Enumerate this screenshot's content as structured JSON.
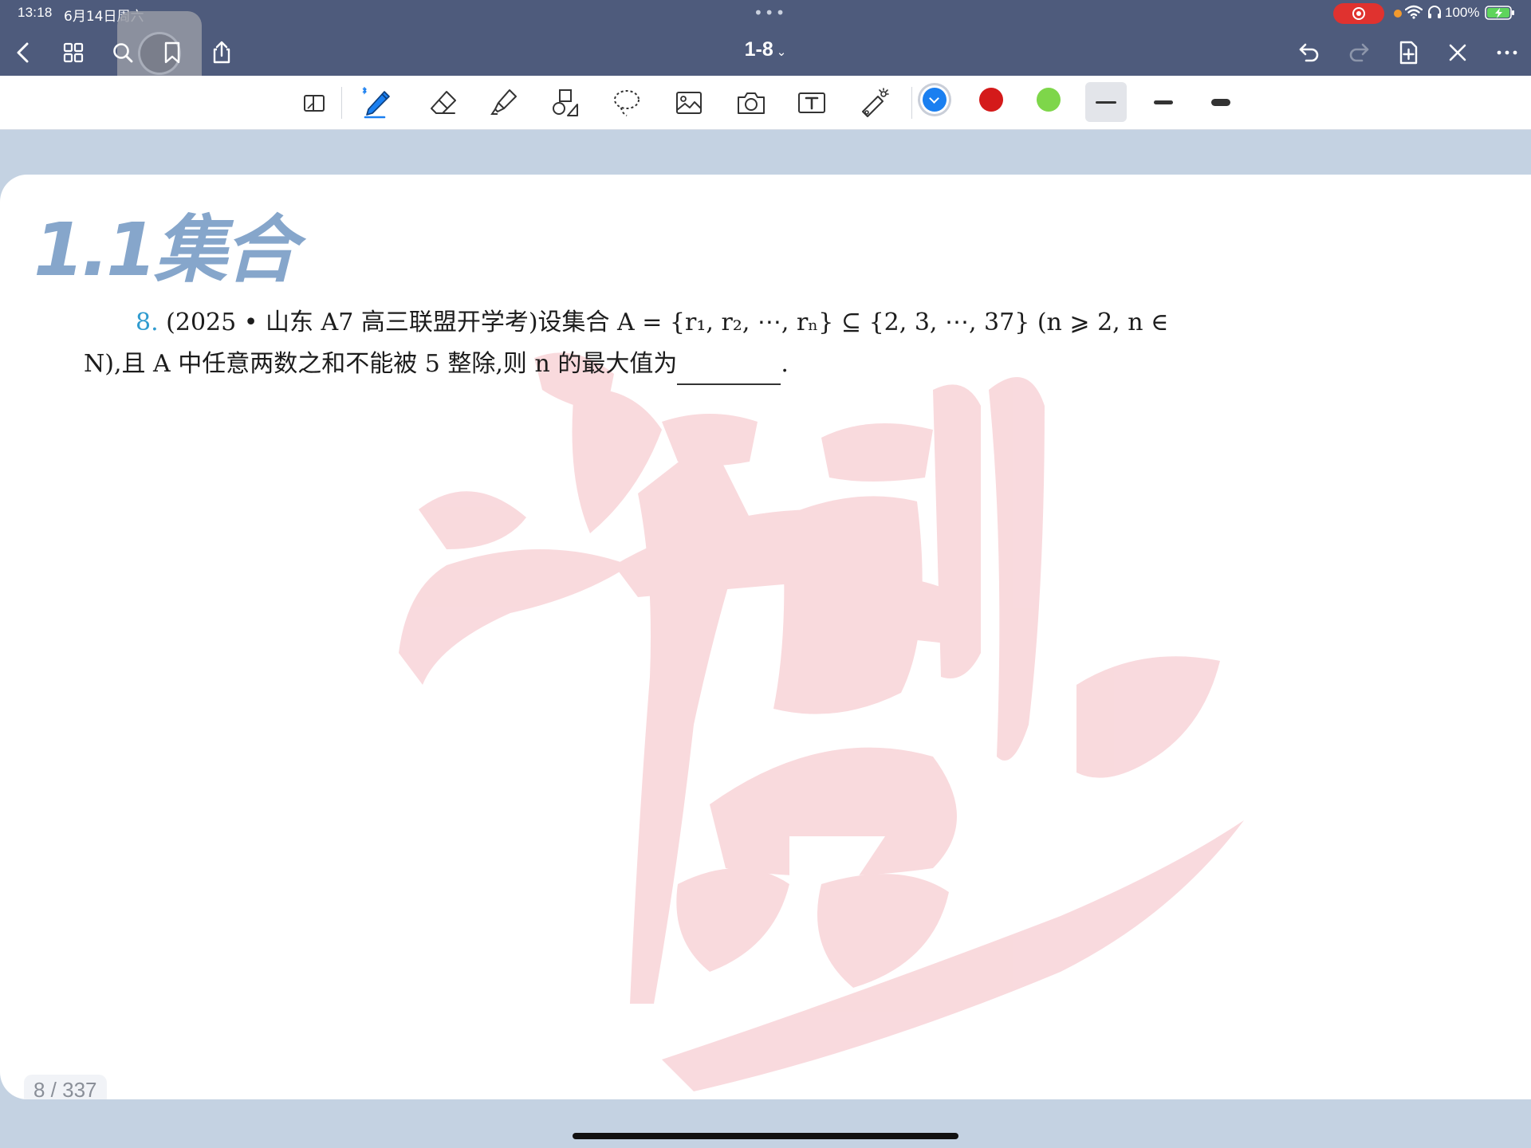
{
  "status_bar": {
    "time": "13:18",
    "date": "6月14日周六",
    "battery": "100%"
  },
  "nav": {
    "doc_title": "1-8",
    "chevron": "⌄"
  },
  "toolbar": {
    "tools": [
      "page-view-icon",
      "pen-icon",
      "eraser-icon",
      "highlighter-icon",
      "shapes-icon",
      "lasso-icon",
      "image-icon",
      "camera-icon",
      "text-box-icon",
      "laser-pointer-icon"
    ],
    "colors": [
      "#1a7ff0",
      "#d41a1a",
      "#7ed64a"
    ],
    "selected_color": "#1a7ff0"
  },
  "page": {
    "heading": "1.1集合",
    "question": {
      "number": "8.",
      "line1": "(2025 • 山东 A7 高三联盟开学考)设集合 A = {r₁, r₂, ⋯, rₙ} ⊆ {2, 3, ⋯, 37} (n ⩾ 2, n ∈",
      "line2_a": "N),且 A 中任意两数之和不能被 5 整除,则 n 的最大值为",
      "line2_end": "."
    },
    "counter": "8 / 337"
  }
}
